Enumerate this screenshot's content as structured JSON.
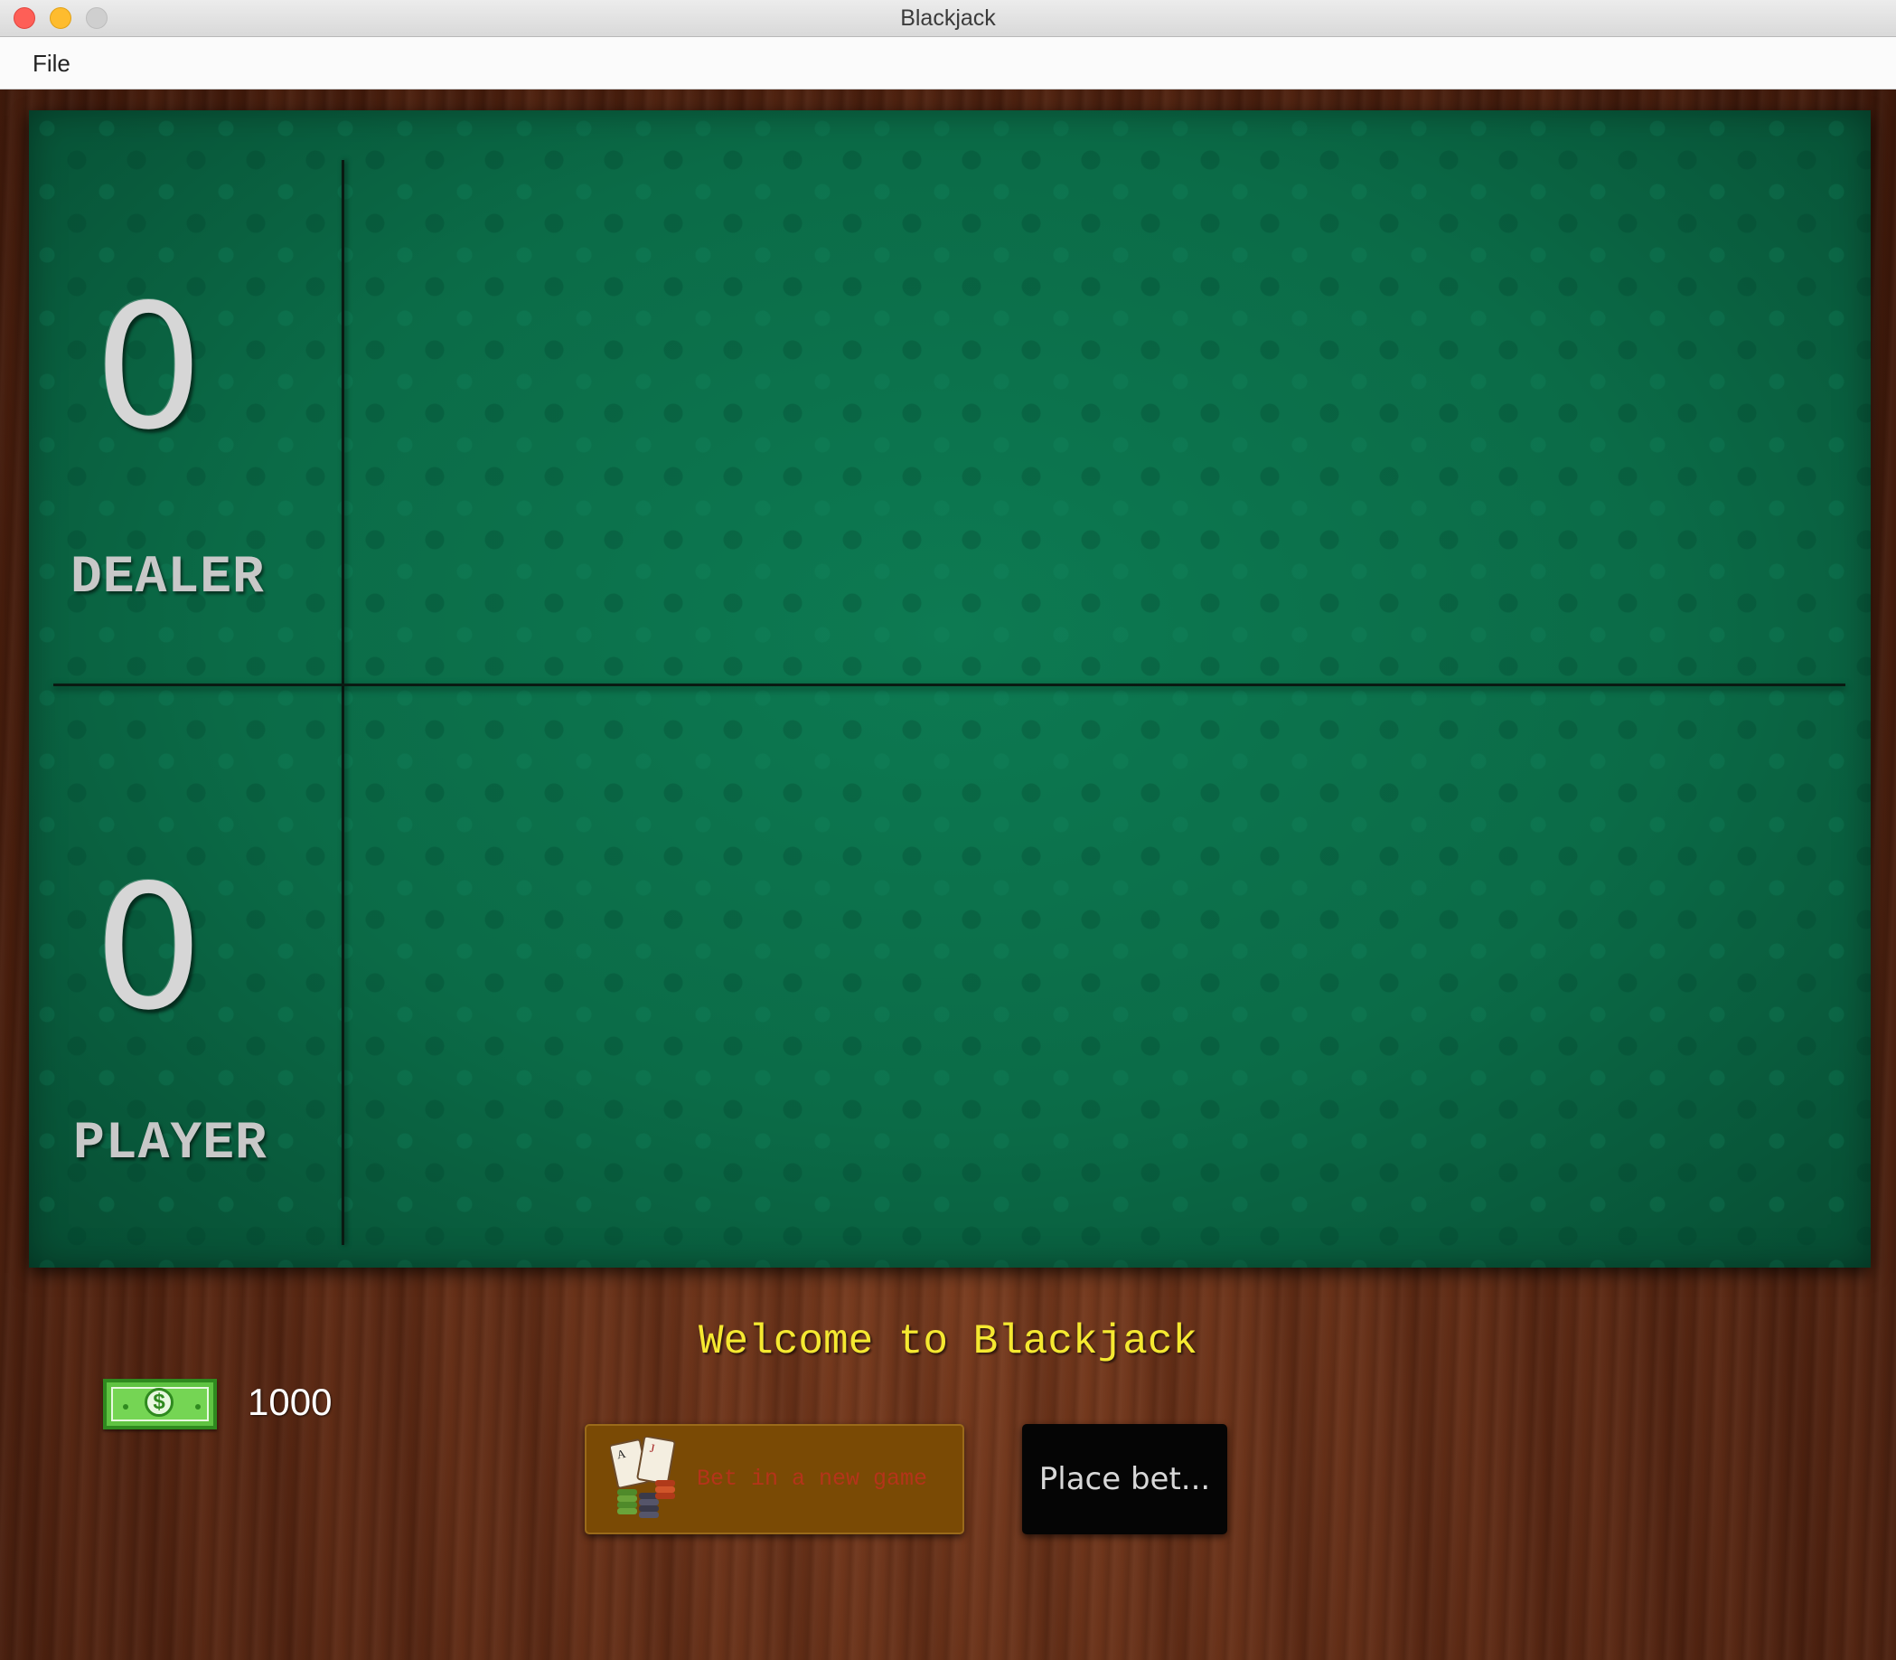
{
  "window": {
    "title": "Blackjack"
  },
  "menubar": {
    "items": [
      {
        "label": "File"
      }
    ]
  },
  "table": {
    "dealer": {
      "score": "0",
      "label": "DEALER"
    },
    "player": {
      "score": "0",
      "label": "PLAYER"
    }
  },
  "status": {
    "message": "Welcome to Blackjack"
  },
  "wallet": {
    "icon": "money-bill-icon",
    "balance": "1000"
  },
  "actions": {
    "bet_new_game": {
      "label": "Bet in a new game",
      "icon": "cards-and-chips-icon"
    },
    "place_bet": {
      "label": "Place bet..."
    }
  },
  "colors": {
    "felt": "#0b6b47",
    "wood": "#5c2a15",
    "welcome_text": "#f5e931",
    "bet_button_bg": "#7a4a05",
    "bet_button_text": "#b4341a",
    "place_bet_bg": "#050505",
    "place_bet_text": "#d8d8d8"
  }
}
